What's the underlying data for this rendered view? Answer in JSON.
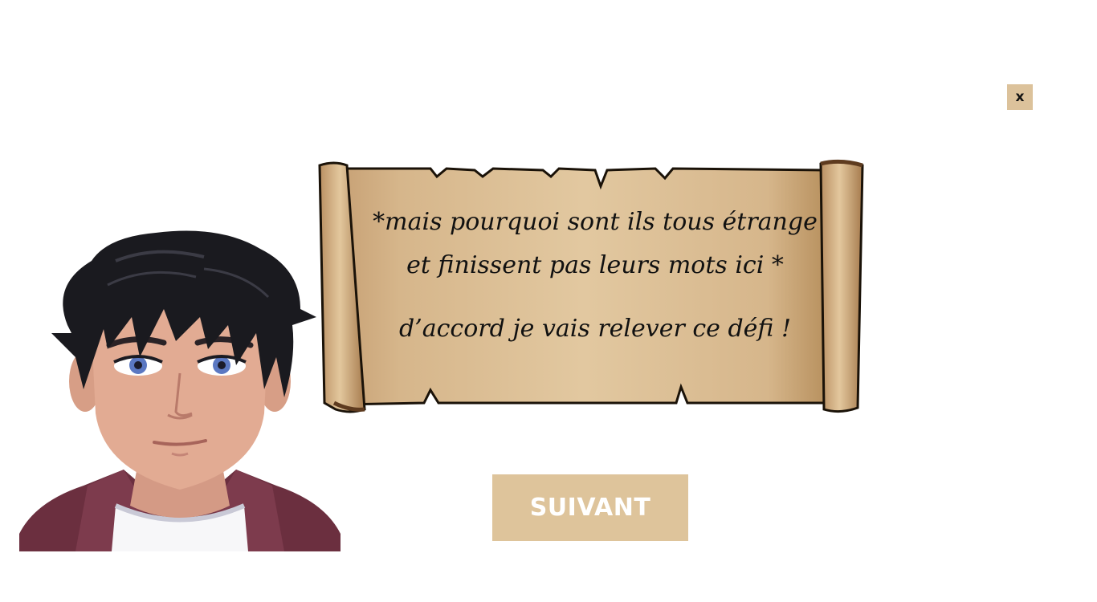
{
  "close_label": "x",
  "dialog": {
    "line1": "*mais pourquoi sont ils tous étrange et finissent pas leurs mots ici *",
    "line2": "d’accord je vais relever ce défi !"
  },
  "next_label": "SUIVANT",
  "colors": {
    "button_bg": "#dec49b",
    "parchment": "#d9b98a",
    "scroll_roll": "#c9a57a"
  },
  "icons": {
    "character": "character-avatar",
    "scroll": "parchment-scroll"
  }
}
